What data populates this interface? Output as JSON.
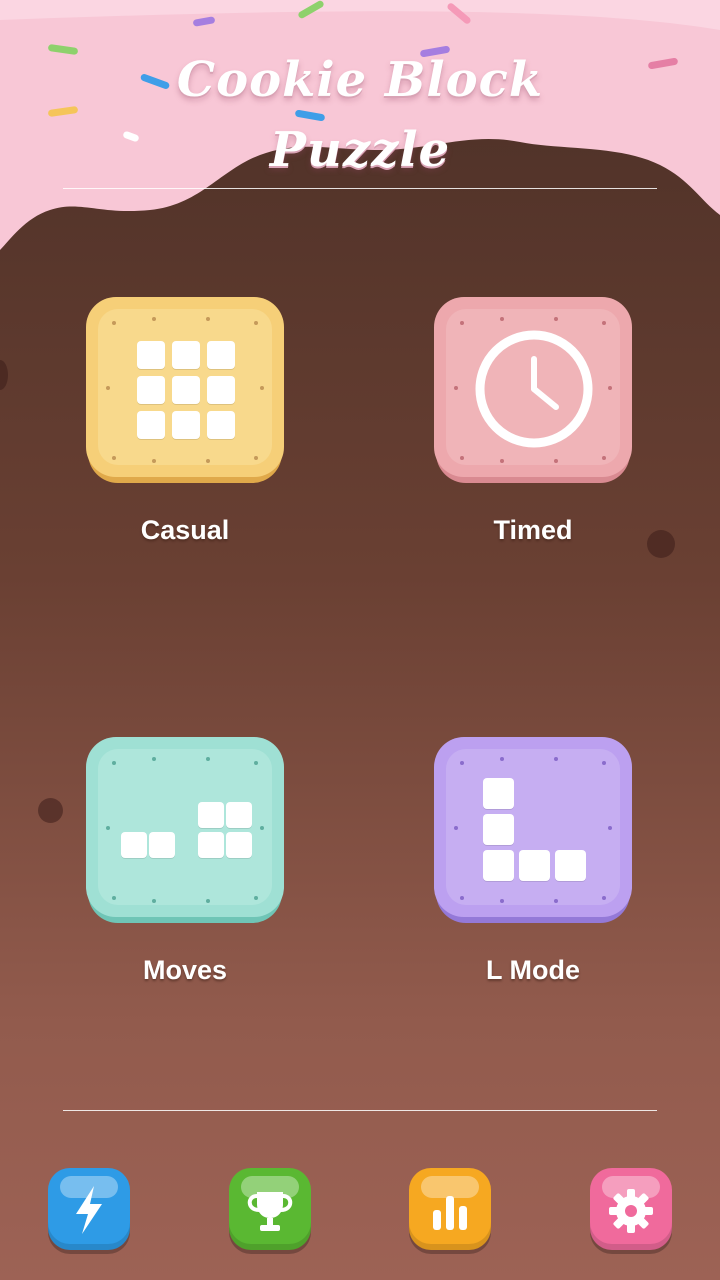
{
  "title": {
    "line1": "Cookie Block",
    "line2": "Puzzle"
  },
  "colors": {
    "frosting": "#f8c7d6",
    "chocolate": "#4a2f26",
    "casual_cookie": "#f6cf78",
    "timed_cookie": "#eda8ad",
    "moves_cookie": "#9fe0d4",
    "lmode_cookie": "#bca0f0",
    "boost_button": "#2e9be6",
    "trophy_button": "#5ab832",
    "stats_button": "#f6a821",
    "settings_button": "#f06a9c"
  },
  "modes": [
    {
      "label": "Casual",
      "icon": "grid-3x3-icon"
    },
    {
      "label": "Timed",
      "icon": "clock-icon"
    },
    {
      "label": "Moves",
      "icon": "blocks-icon"
    },
    {
      "label": "L Mode",
      "icon": "l-shape-icon"
    }
  ],
  "nav": [
    {
      "icon": "lightning-icon"
    },
    {
      "icon": "trophy-icon"
    },
    {
      "icon": "bar-chart-icon"
    },
    {
      "icon": "gear-icon"
    }
  ]
}
